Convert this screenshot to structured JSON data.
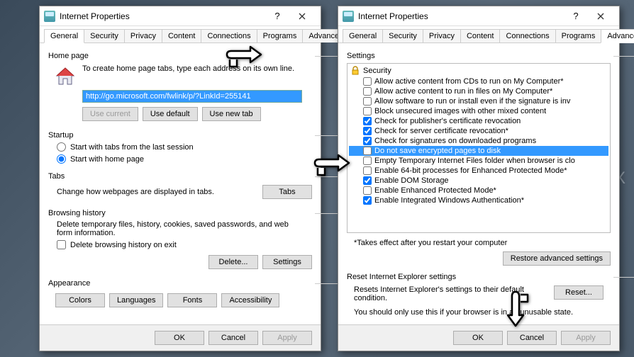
{
  "window_title": "Internet Properties",
  "left": {
    "tabs": [
      "General",
      "Security",
      "Privacy",
      "Content",
      "Connections",
      "Programs",
      "Advanced"
    ],
    "active_tab": 0,
    "home": {
      "label": "Home page",
      "instruction": "To create home page tabs, type each address on its own line.",
      "url": "http://go.microsoft.com/fwlink/p/?LinkId=255141",
      "btn_current": "Use current",
      "btn_default": "Use default",
      "btn_newtab": "Use new tab"
    },
    "startup": {
      "label": "Startup",
      "opt_last": "Start with tabs from the last session",
      "opt_home": "Start with home page"
    },
    "tabs_section": {
      "label": "Tabs",
      "desc": "Change how webpages are displayed in tabs.",
      "btn": "Tabs"
    },
    "history": {
      "label": "Browsing history",
      "desc": "Delete temporary files, history, cookies, saved passwords, and web form information.",
      "chk": "Delete browsing history on exit",
      "btn_delete": "Delete...",
      "btn_settings": "Settings"
    },
    "appearance": {
      "label": "Appearance",
      "btn_colors": "Colors",
      "btn_lang": "Languages",
      "btn_fonts": "Fonts",
      "btn_access": "Accessibility"
    }
  },
  "right": {
    "tabs": [
      "General",
      "Security",
      "Privacy",
      "Content",
      "Connections",
      "Programs",
      "Advanced"
    ],
    "active_tab": 6,
    "settings_label": "Settings",
    "tree_root": "Security",
    "items": [
      {
        "checked": false,
        "label": "Allow active content from CDs to run on My Computer*"
      },
      {
        "checked": false,
        "label": "Allow active content to run in files on My Computer*"
      },
      {
        "checked": false,
        "label": "Allow software to run or install even if the signature is inv"
      },
      {
        "checked": false,
        "label": "Block unsecured images with other mixed content"
      },
      {
        "checked": true,
        "label": "Check for publisher's certificate revocation"
      },
      {
        "checked": true,
        "label": "Check for server certificate revocation*"
      },
      {
        "checked": true,
        "label": "Check for signatures on downloaded programs"
      },
      {
        "checked": false,
        "label": "Do not save encrypted pages to disk",
        "selected": true
      },
      {
        "checked": false,
        "label": "Empty Temporary Internet Files folder when browser is clo"
      },
      {
        "checked": false,
        "label": "Enable 64-bit processes for Enhanced Protected Mode*"
      },
      {
        "checked": true,
        "label": "Enable DOM Storage"
      },
      {
        "checked": false,
        "label": "Enable Enhanced Protected Mode*"
      },
      {
        "checked": true,
        "label": "Enable Integrated Windows Authentication*"
      }
    ],
    "note": "*Takes effect after you restart your computer",
    "btn_restore": "Restore advanced settings",
    "reset": {
      "label": "Reset Internet Explorer settings",
      "desc": "Resets Internet Explorer's settings to their default condition.",
      "btn": "Reset...",
      "warn": "You should only use this if your browser is in an unusable state."
    }
  },
  "buttons": {
    "ok": "OK",
    "cancel": "Cancel",
    "apply": "Apply"
  }
}
